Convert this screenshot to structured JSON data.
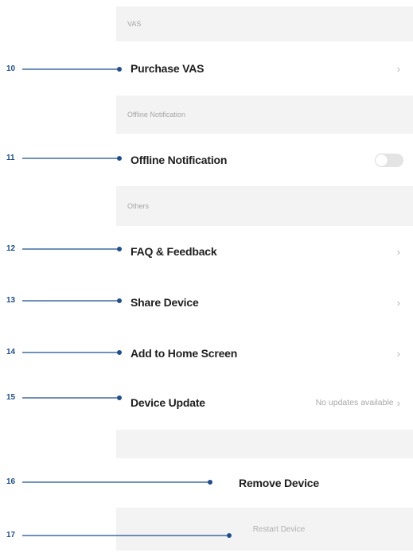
{
  "sections": {
    "vas_header": "VAS",
    "offline_header": "Offline Notification",
    "others_header": "Others"
  },
  "rows": {
    "purchase_vas": "Purchase VAS",
    "offline_notification": "Offline Notification",
    "offline_notification_enabled": false,
    "faq_feedback": "FAQ & Feedback",
    "share_device": "Share Device",
    "add_to_home_screen": "Add to Home Screen",
    "device_update": "Device Update",
    "device_update_status": "No updates available"
  },
  "actions": {
    "remove_device": "Remove Device",
    "restart_device": "Restart Device"
  },
  "callouts": {
    "c10": "10",
    "c11": "11",
    "c12": "12",
    "c13": "13",
    "c14": "14",
    "c15": "15",
    "c16": "16",
    "c17": "17"
  },
  "colors": {
    "callout_line": "#1f4e8c",
    "section_background": "#f3f3f3",
    "toggle_off": "#e4e4e4"
  },
  "icons": {
    "chevron": "chevron-right-icon",
    "toggle": "toggle-switch-off"
  }
}
